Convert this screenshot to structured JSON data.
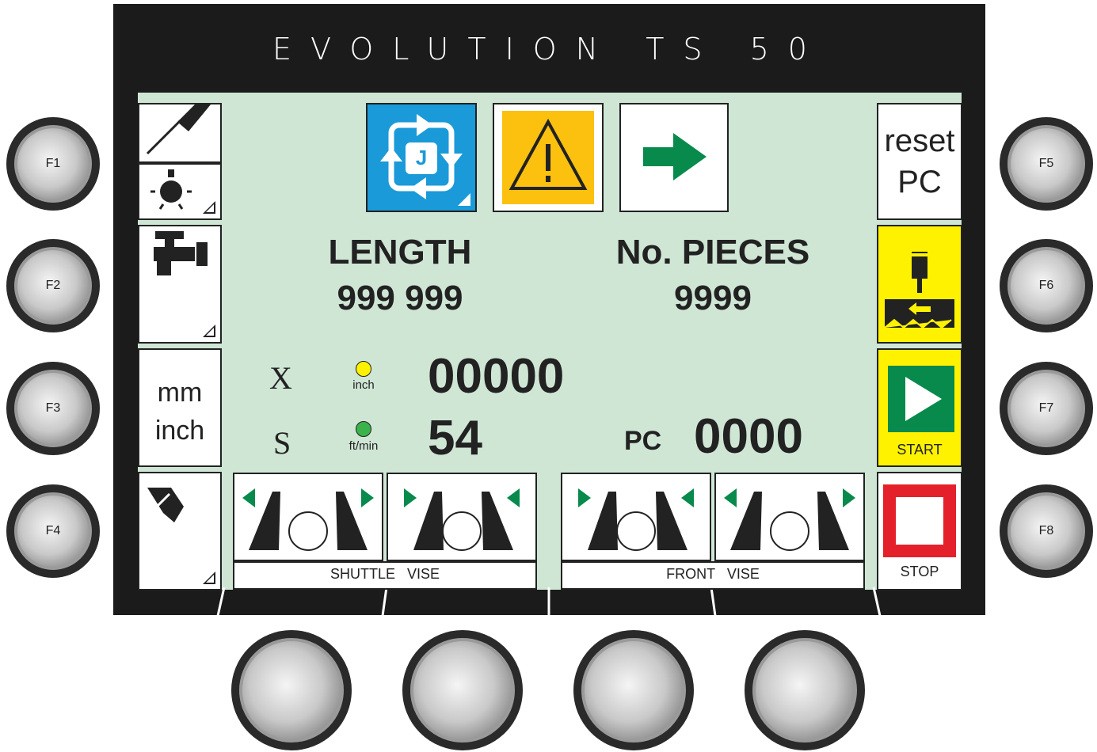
{
  "header": {
    "title": "EVOLUTION TS 50"
  },
  "function_keys": {
    "f1": "F1",
    "f2": "F2",
    "f3": "F3",
    "f4": "F4",
    "f5": "F5",
    "f6": "F6",
    "f7": "F7",
    "f8": "F8"
  },
  "left_panel": {
    "unit_mm": "mm",
    "unit_inch": "inch"
  },
  "right_panel": {
    "reset_line1": "reset",
    "reset_line2": "PC",
    "start_label": "START",
    "stop_label": "STOP"
  },
  "top_icons": {
    "cycle_letter": "J"
  },
  "counters": {
    "length_label": "LENGTH",
    "length_value": "999 999",
    "pieces_label": "No. PIECES",
    "pieces_value": "9999"
  },
  "readouts": {
    "x_label": "X",
    "x_unit": "inch",
    "x_value": "00000",
    "s_label": "S",
    "s_unit": "ft/min",
    "s_value": "54",
    "pc_label": "PC",
    "pc_value": "0000"
  },
  "vises": {
    "shuttle_label": "SHUTTLE   VISE",
    "front_label": "FRONT   VISE"
  },
  "colors": {
    "screen": "#cfe6d5",
    "accent_blue": "#1a9ad8",
    "warning": "#fcc00f",
    "green": "#078a4c",
    "yellow": "#fff200",
    "stop_red": "#e4212a"
  }
}
